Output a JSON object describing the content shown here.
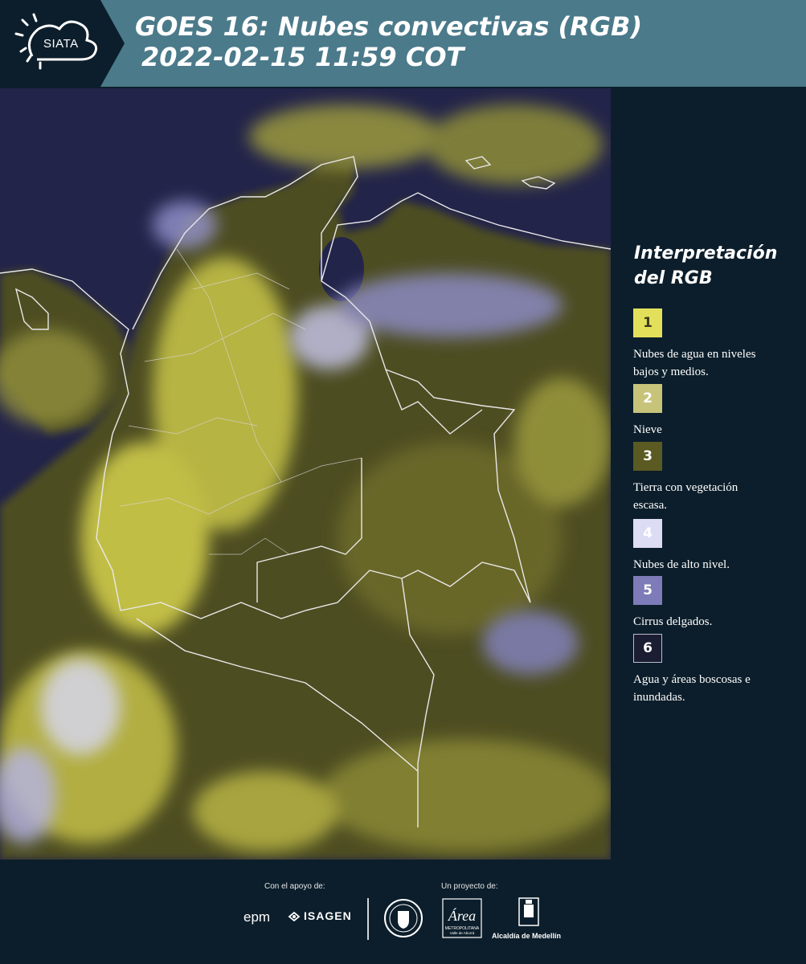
{
  "header": {
    "logo_text": "SIATA",
    "title_line1": "GOES 16: Nubes convectivas (RGB)",
    "title_line2": "2022-02-15 11:59 COT",
    "background_color": "#4b7a8a"
  },
  "map": {
    "background_color": "#23244a",
    "border_color": "#e8e8e8"
  },
  "legend": {
    "title_line1": "Interpretación",
    "title_line2": "del RGB",
    "items": [
      {
        "number": "1",
        "label": "Nubes de agua en niveles bajos y medios.",
        "color": "#e2e05a",
        "text_color": "#3a3a1a"
      },
      {
        "number": "2",
        "label": "Nieve",
        "color": "#c7c47a",
        "text_color": "#ffffff"
      },
      {
        "number": "3",
        "label": "Tierra con vegetación escasa.",
        "color": "#5b5a22",
        "text_color": "#ffffff"
      },
      {
        "number": "4",
        "label": "Nubes de alto nivel.",
        "color": "#dcdcf4",
        "text_color": "#ffffff"
      },
      {
        "number": "5",
        "label": "Cirrus delgados.",
        "color": "#7d7cb8",
        "text_color": "#ffffff"
      },
      {
        "number": "6",
        "label": "Agua y áreas boscosas e inundadas.",
        "color": "#1b1d33",
        "text_color": "#ffffff"
      }
    ]
  },
  "footer": {
    "support_label": "Con el apoyo de:",
    "project_label": "Un proyecto de:",
    "sponsor_epm": "epm",
    "sponsor_isagen": "ISAGEN",
    "partner_metro_1": "METROPOLITANA",
    "partner_metro_2": "Valle de Aburrá",
    "partner_alcaldia": "Alcaldía de Medellín",
    "background_color": "#0c1e2b"
  }
}
